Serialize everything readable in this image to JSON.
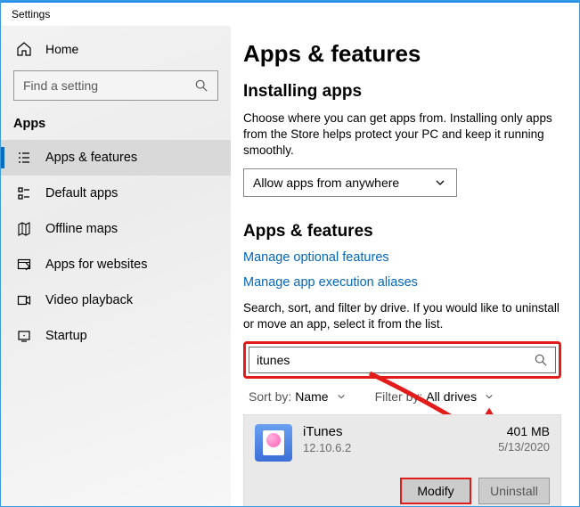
{
  "window": {
    "title": "Settings"
  },
  "sidebar": {
    "home": "Home",
    "search_placeholder": "Find a setting",
    "section": "Apps",
    "items": [
      {
        "label": "Apps & features",
        "selected": true
      },
      {
        "label": "Default apps"
      },
      {
        "label": "Offline maps"
      },
      {
        "label": "Apps for websites"
      },
      {
        "label": "Video playback"
      },
      {
        "label": "Startup"
      }
    ]
  },
  "main": {
    "title": "Apps & features",
    "installing": {
      "heading": "Installing apps",
      "desc": "Choose where you can get apps from. Installing only apps from the Store helps protect your PC and keep it running smoothly.",
      "combo_value": "Allow apps from anywhere"
    },
    "apps_section": {
      "heading": "Apps & features",
      "link_optional": "Manage optional features",
      "link_aliases": "Manage app execution aliases",
      "desc": "Search, sort, and filter by drive. If you would like to uninstall or move an app, select it from the list.",
      "search_value": "itunes",
      "sort_label": "Sort by:",
      "sort_value": "Name",
      "filter_label": "Filter by:",
      "filter_value": "All drives"
    },
    "app": {
      "name": "iTunes",
      "version": "12.10.6.2",
      "size": "401 MB",
      "date": "5/13/2020",
      "modify": "Modify",
      "uninstall": "Uninstall"
    }
  }
}
